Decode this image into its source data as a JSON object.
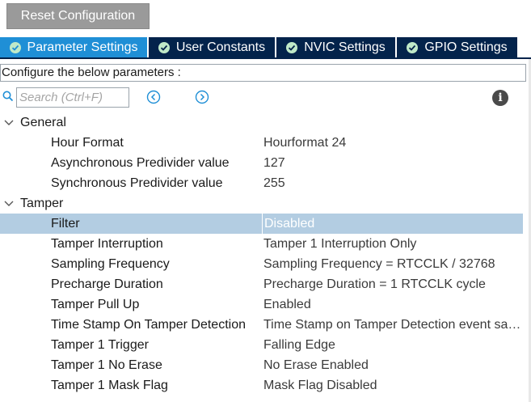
{
  "toolbar": {
    "reset_label": "Reset Configuration"
  },
  "tabs": [
    {
      "label": "Parameter Settings",
      "active": true
    },
    {
      "label": "User Constants",
      "active": false
    },
    {
      "label": "NVIC Settings",
      "active": false
    },
    {
      "label": "GPIO Settings",
      "active": false
    }
  ],
  "configure_label": "Configure the below parameters :",
  "search": {
    "placeholder": "Search (Ctrl+F)"
  },
  "icons": {
    "search": "search-icon",
    "prev": "circle-arrow-left-icon",
    "next": "circle-arrow-right-icon",
    "info": "info-icon",
    "expand": "chevron-down-icon",
    "tab_check": "check-circle-icon"
  },
  "colors": {
    "tab_active": "#1f8fd6",
    "tab_inactive": "#03234b",
    "selected_row": "#b3cde2",
    "reset_button": "#9a9a9a"
  },
  "groups": [
    {
      "label": "General",
      "params": [
        {
          "name": "Hour Format",
          "value": "Hourformat 24"
        },
        {
          "name": "Asynchronous Predivider value",
          "value": "127"
        },
        {
          "name": "Synchronous Predivider value",
          "value": "255"
        }
      ]
    },
    {
      "label": "Tamper",
      "params": [
        {
          "name": "Filter",
          "value": "Disabled",
          "selected": true
        },
        {
          "name": "Tamper Interruption",
          "value": "Tamper 1 Interruption Only"
        },
        {
          "name": "Sampling Frequency",
          "value": "Sampling Frequency = RTCCLK / 32768"
        },
        {
          "name": "Precharge Duration",
          "value": "Precharge Duration = 1 RTCCLK cycle"
        },
        {
          "name": "Tamper Pull Up",
          "value": "Enabled"
        },
        {
          "name": "Time Stamp On Tamper Detection",
          "value": "Time Stamp on Tamper Detection event save..."
        },
        {
          "name": "Tamper 1 Trigger",
          "value": "Falling Edge"
        },
        {
          "name": "Tamper 1 No Erase",
          "value": "No Erase Enabled"
        },
        {
          "name": "Tamper 1 Mask Flag",
          "value": "Mask Flag Disabled"
        }
      ]
    }
  ]
}
